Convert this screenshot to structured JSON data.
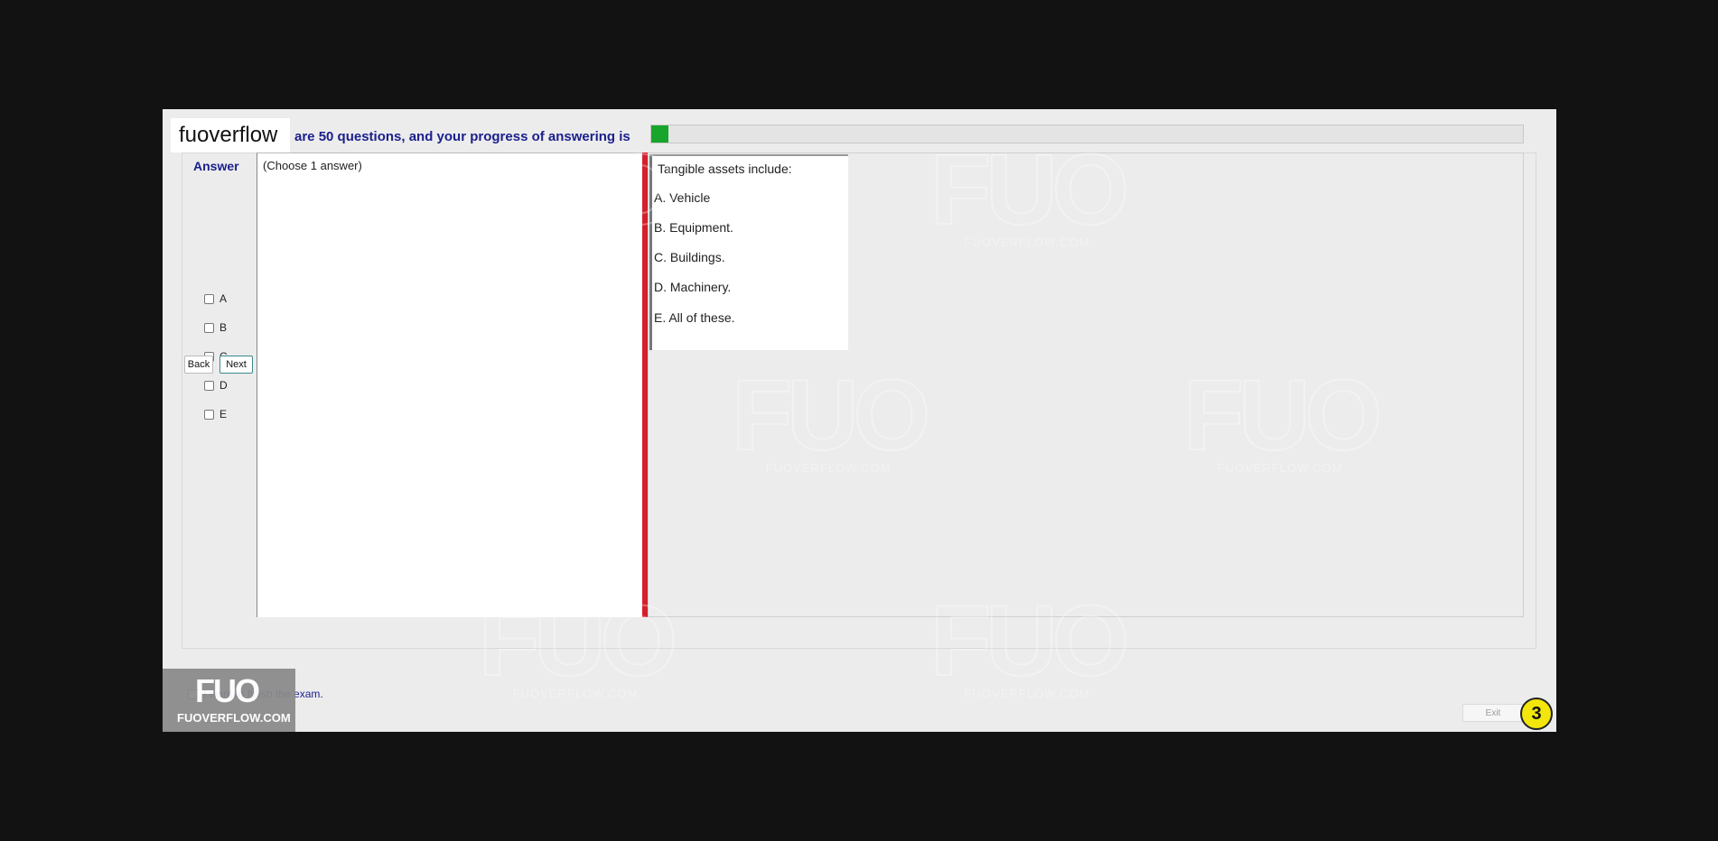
{
  "brand": "fuoverflow",
  "progress": {
    "text": "are 50 questions, and your progress of answering is",
    "value": 0.02,
    "color": "#18a52c"
  },
  "answer_panel": {
    "title": "Answer",
    "options": [
      "A",
      "B",
      "C",
      "D",
      "E"
    ],
    "back_label": "Back",
    "next_label": "Next"
  },
  "left_pane": {
    "instruction": "(Choose 1 answer)"
  },
  "question": {
    "prompt": "Tangible assets include:",
    "choices": [
      "A.  Vehicle",
      "B.  Equipment.",
      "C.  Buildings.",
      "D.  Machinery.",
      "E.  All of these."
    ]
  },
  "finish": {
    "label": "I want to finish the exam."
  },
  "exit_label": "Exit",
  "question_number": "3",
  "watermark": {
    "logo": "FUO",
    "site": "FUOVERFLOW.COM"
  },
  "colors": {
    "accent_text": "#1b1f8c",
    "splitter": "#d3202c",
    "badge": "#f2e60c"
  }
}
